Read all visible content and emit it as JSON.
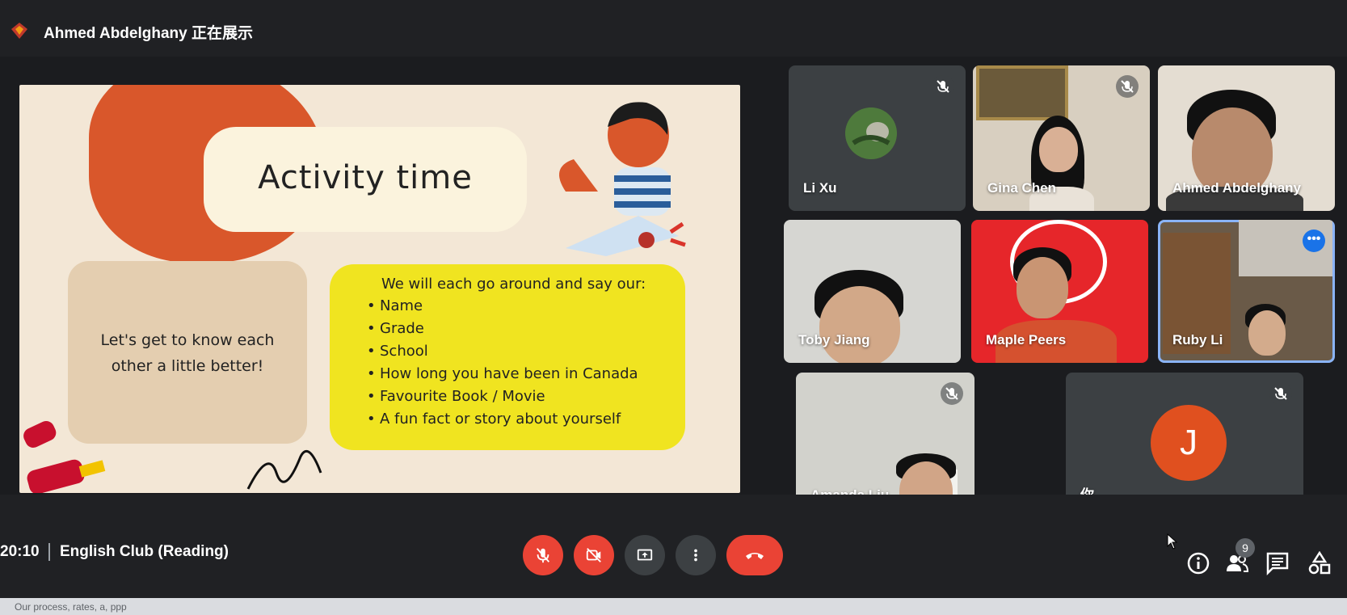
{
  "top_bar": {
    "presenter_label": "Ahmed Abdelghany 正在展示"
  },
  "slide": {
    "title": "Activity time",
    "left_text_line1": "Let's get to know each",
    "left_text_line2": "other a little better!",
    "right_heading": "We will each go around and say our:",
    "bullet": "•",
    "items": [
      "Name",
      "Grade",
      "School",
      "How long you have been in Canada",
      "Favourite Book / Movie",
      "A fun fact or story about yourself"
    ]
  },
  "participants": [
    {
      "name": "Li Xu",
      "muted": true
    },
    {
      "name": "Gina Chen",
      "muted": true
    },
    {
      "name": "Ahmed Abdelghany",
      "muted": false
    },
    {
      "name": "Toby Jiang",
      "muted": false
    },
    {
      "name": "Maple Peers",
      "muted": false
    },
    {
      "name": "Ruby Li",
      "muted": false,
      "more": "•••"
    },
    {
      "name": "Amanda Liu",
      "muted": true
    },
    {
      "name": "你",
      "muted": true,
      "avatar_letter": "J"
    }
  ],
  "bottom_bar": {
    "time": "20:10",
    "separator": "|",
    "meeting_title": "English Club (Reading)",
    "participants_count": "9",
    "browser_tab_text": "Our process, rates, a, ppp"
  },
  "icons": {
    "presenter": "presenter-logo-icon",
    "mic_off": "mic-off-icon",
    "cam_off": "camera-off-icon",
    "present": "present-screen-icon",
    "more": "more-vert-icon",
    "hangup": "hang-up-icon",
    "info": "info-icon",
    "people": "people-icon",
    "chat": "chat-icon",
    "activities": "activities-icon"
  },
  "colors": {
    "red": "#ea4335",
    "grey_button": "#3c4043",
    "active_border": "#8ab4f8",
    "avatar_j": "#e0501f"
  }
}
